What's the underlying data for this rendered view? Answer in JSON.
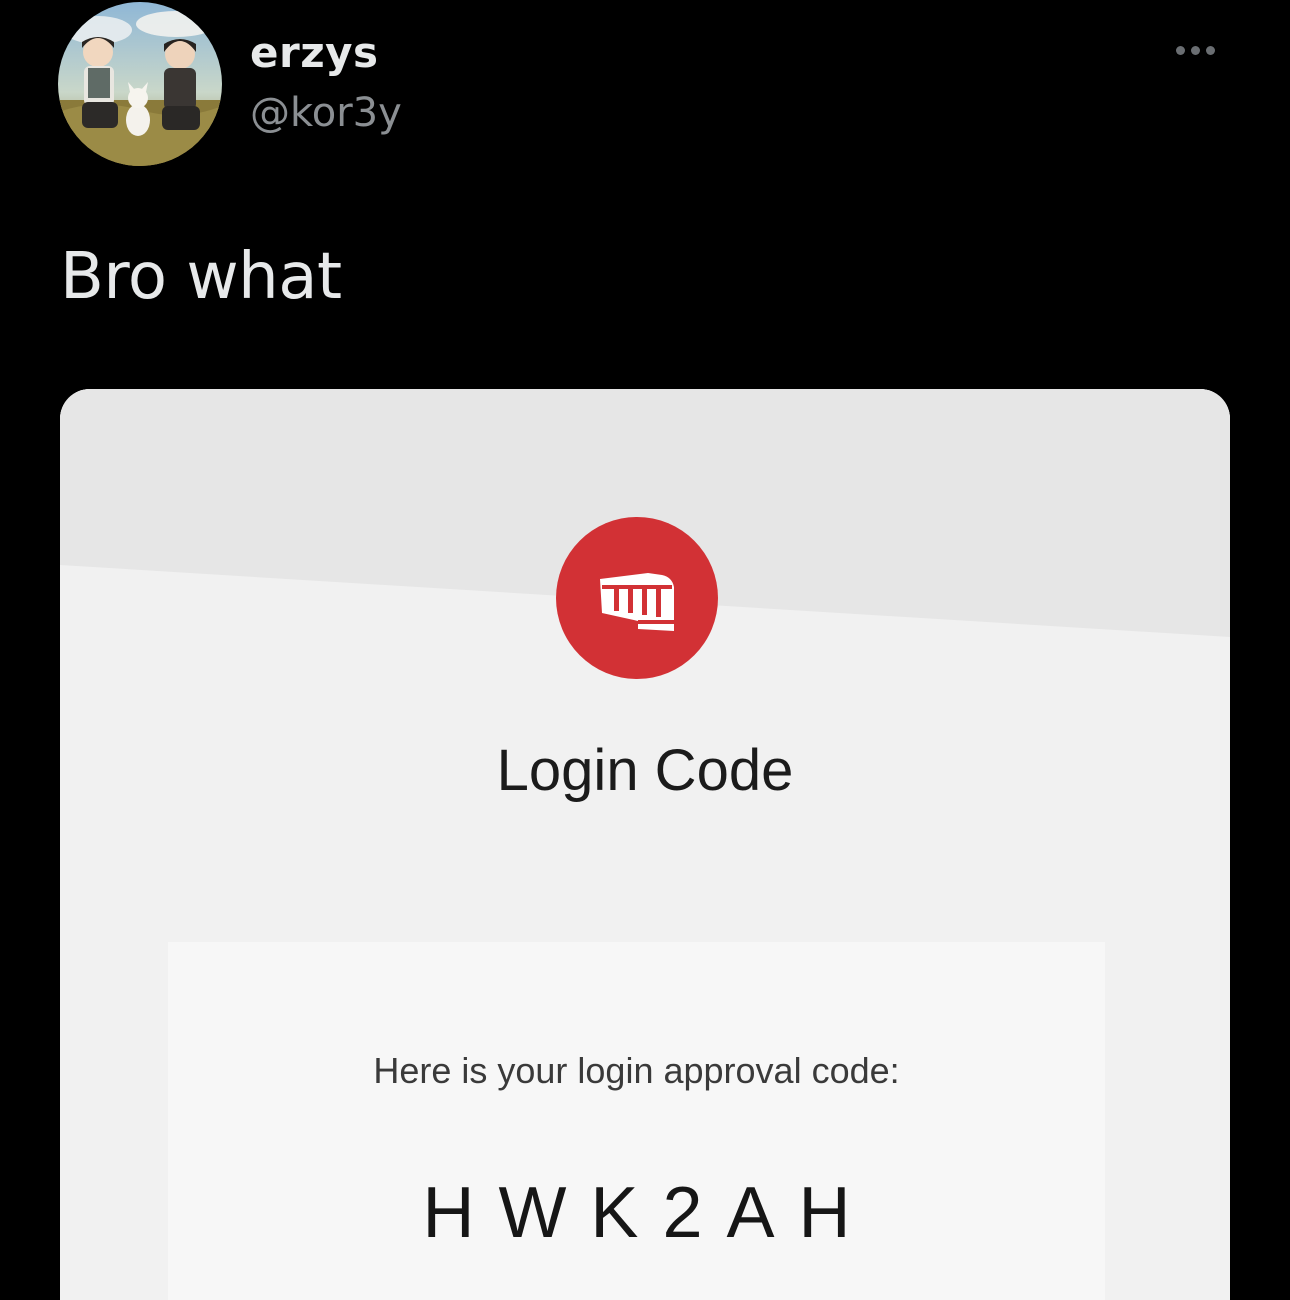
{
  "tweet": {
    "author": {
      "display_name": "erzys",
      "handle": "@kor3y",
      "avatar_icon": "anime-profile-picture"
    },
    "more_icon": "more-horizontal-icon",
    "text": "Bro what"
  },
  "email": {
    "logo_icon": "riot-games-fist-icon",
    "brand_color": "#d23135",
    "title": "Login Code",
    "prompt": "Here is your login approval code:",
    "code": "HWK2AH"
  }
}
